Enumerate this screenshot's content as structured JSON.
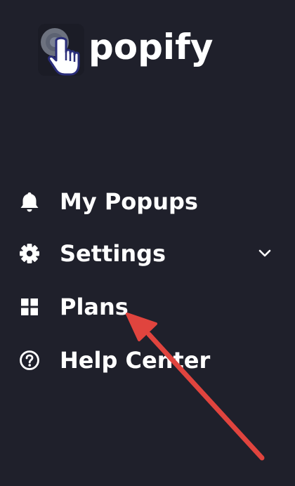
{
  "app": {
    "logo_text": "popify"
  },
  "nav": {
    "items": [
      {
        "label": "My Popups",
        "icon": "bell-icon"
      },
      {
        "label": "Settings",
        "icon": "gear-icon",
        "has_submenu": true
      },
      {
        "label": "Plans",
        "icon": "grid-icon"
      },
      {
        "label": "Help Center",
        "icon": "help-circle-icon"
      }
    ]
  },
  "colors": {
    "background": "#1f202b",
    "text": "#ffffff",
    "annotation_arrow": "#e0443e"
  }
}
